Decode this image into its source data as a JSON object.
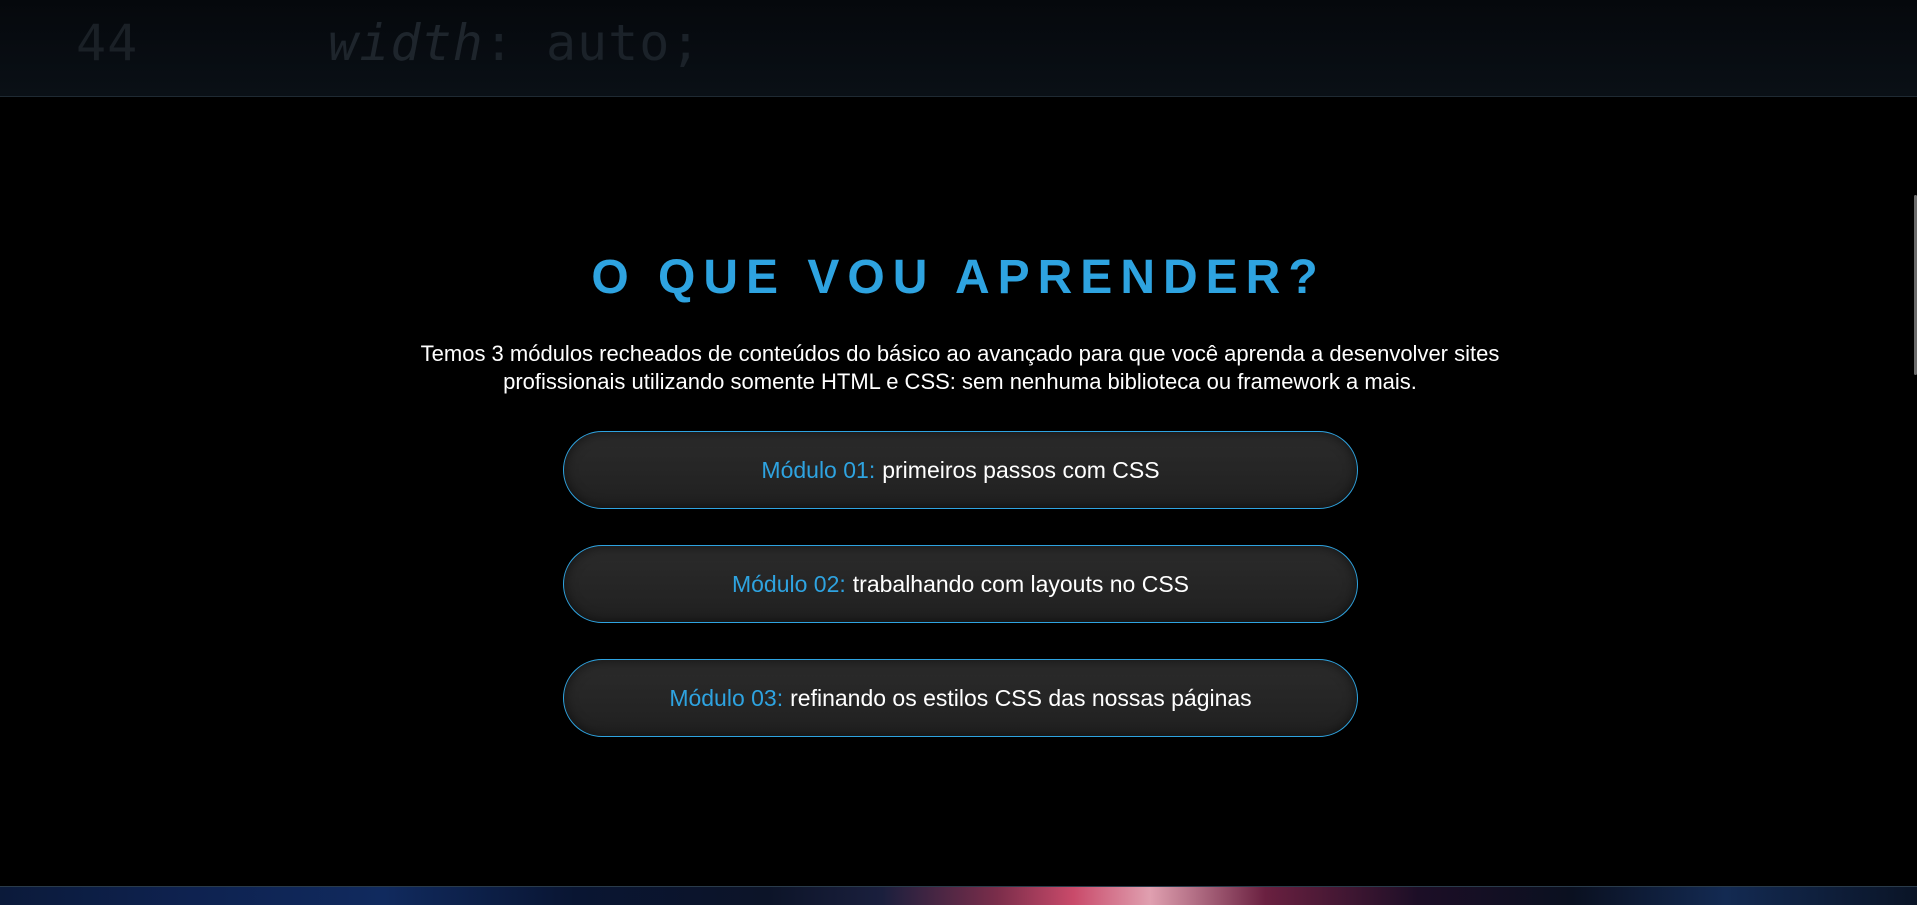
{
  "top_strip": {
    "line_number": "44",
    "code_keyword": "width",
    "code_value": ": auto;"
  },
  "section": {
    "title": "O QUE VOU APRENDER?",
    "description": "Temos 3 módulos recheados de conteúdos do básico ao avançado para que você aprenda a desenvolver sites profissionais utilizando somente HTML e CSS: sem nenhuma biblioteca ou framework a mais.",
    "modules": [
      {
        "label": "Módulo 01:",
        "text": "primeiros passos com CSS"
      },
      {
        "label": "Módulo 02:",
        "text": "trabalhando com layouts no CSS"
      },
      {
        "label": "Módulo 03:",
        "text": "refinando os estilos CSS das nossas páginas"
      }
    ]
  },
  "colors": {
    "accent": "#2ea3e0",
    "background": "#000000",
    "card": "#262626",
    "text": "#ffffff"
  }
}
